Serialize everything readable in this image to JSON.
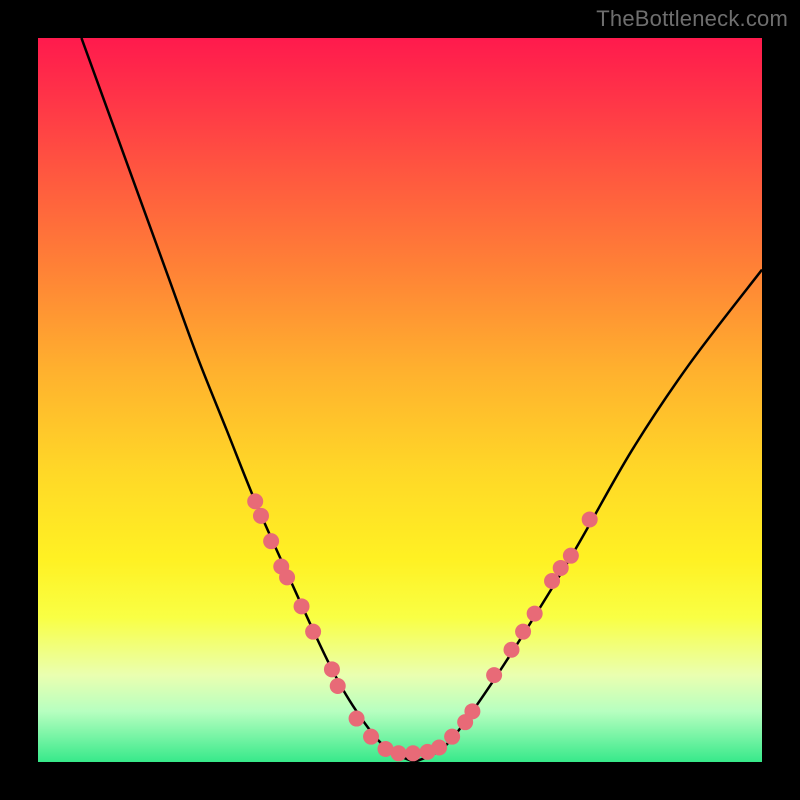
{
  "watermark": "TheBottleneck.com",
  "colors": {
    "frame_bg": "#000000",
    "gradient_top": "#ff1a4d",
    "gradient_bottom": "#37e98a",
    "curve_stroke": "#000000",
    "dot_fill": "#e86a77"
  },
  "chart_data": {
    "type": "line",
    "title": "",
    "xlabel": "",
    "ylabel": "",
    "xlim": [
      0,
      100
    ],
    "ylim": [
      0,
      100
    ],
    "grid": false,
    "legend": false,
    "series": [
      {
        "name": "left-curve",
        "x": [
          6,
          10,
          14,
          18,
          22,
          26,
          30,
          34,
          40,
          44,
          48,
          52
        ],
        "y": [
          100,
          89,
          78,
          67,
          56,
          46,
          36,
          27,
          14,
          7,
          2,
          0
        ]
      },
      {
        "name": "right-curve",
        "x": [
          52,
          56,
          60,
          66,
          74,
          82,
          90,
          100
        ],
        "y": [
          0,
          2,
          7,
          16,
          29,
          43,
          55,
          68
        ]
      }
    ],
    "dots": [
      {
        "x": 30.0,
        "y": 36.0
      },
      {
        "x": 30.8,
        "y": 34.0
      },
      {
        "x": 32.2,
        "y": 30.5
      },
      {
        "x": 33.6,
        "y": 27.0
      },
      {
        "x": 34.4,
        "y": 25.5
      },
      {
        "x": 36.4,
        "y": 21.5
      },
      {
        "x": 38.0,
        "y": 18.0
      },
      {
        "x": 40.6,
        "y": 12.8
      },
      {
        "x": 41.4,
        "y": 10.5
      },
      {
        "x": 44.0,
        "y": 6.0
      },
      {
        "x": 46.0,
        "y": 3.5
      },
      {
        "x": 48.0,
        "y": 1.8
      },
      {
        "x": 49.8,
        "y": 1.2
      },
      {
        "x": 51.8,
        "y": 1.2
      },
      {
        "x": 53.8,
        "y": 1.4
      },
      {
        "x": 55.4,
        "y": 2.0
      },
      {
        "x": 57.2,
        "y": 3.5
      },
      {
        "x": 59.0,
        "y": 5.5
      },
      {
        "x": 60.0,
        "y": 7.0
      },
      {
        "x": 63.0,
        "y": 12.0
      },
      {
        "x": 65.4,
        "y": 15.5
      },
      {
        "x": 67.0,
        "y": 18.0
      },
      {
        "x": 68.6,
        "y": 20.5
      },
      {
        "x": 71.0,
        "y": 25.0
      },
      {
        "x": 72.2,
        "y": 26.8
      },
      {
        "x": 73.6,
        "y": 28.5
      },
      {
        "x": 76.2,
        "y": 33.5
      }
    ]
  }
}
